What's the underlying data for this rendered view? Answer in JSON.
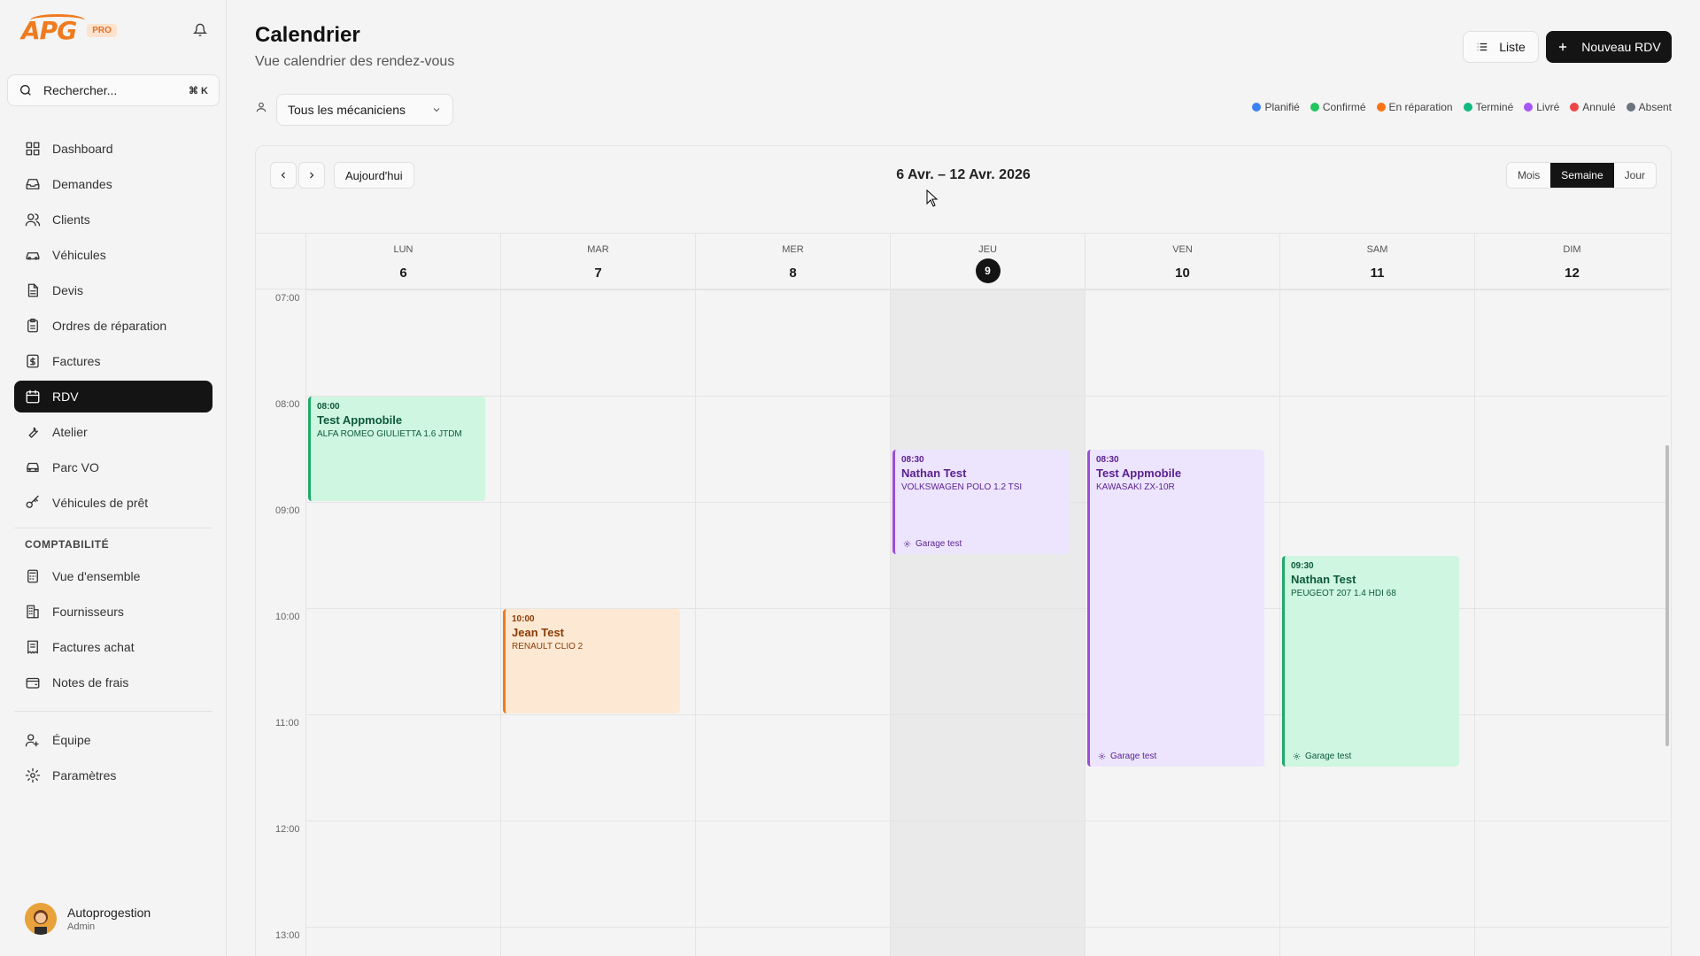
{
  "app": {
    "logo_text": "APG",
    "badge": "PRO"
  },
  "search": {
    "placeholder": "Rechercher...",
    "shortcut": "⌘ K"
  },
  "nav": {
    "items": [
      {
        "label": "Dashboard",
        "icon": "dashboard-icon"
      },
      {
        "label": "Demandes",
        "icon": "inbox-icon"
      },
      {
        "label": "Clients",
        "icon": "users-icon"
      },
      {
        "label": "Véhicules",
        "icon": "car-icon"
      },
      {
        "label": "Devis",
        "icon": "document-icon"
      },
      {
        "label": "Ordres de réparation",
        "icon": "clipboard-icon"
      },
      {
        "label": "Factures",
        "icon": "invoice-icon"
      },
      {
        "label": "RDV",
        "icon": "calendar-icon"
      },
      {
        "label": "Atelier",
        "icon": "wrench-icon"
      },
      {
        "label": "Parc VO",
        "icon": "car-front-icon"
      },
      {
        "label": "Véhicules de prêt",
        "icon": "key-icon"
      }
    ],
    "section_accounting": "COMPTABILITÉ",
    "accounting_items": [
      {
        "label": "Vue d'ensemble",
        "icon": "calculator-icon"
      },
      {
        "label": "Fournisseurs",
        "icon": "building-icon"
      },
      {
        "label": "Factures achat",
        "icon": "receipt-icon"
      },
      {
        "label": "Notes de frais",
        "icon": "wallet-icon"
      }
    ],
    "bottom_items": [
      {
        "label": "Équipe",
        "icon": "team-icon"
      },
      {
        "label": "Paramètres",
        "icon": "settings-icon"
      }
    ]
  },
  "user": {
    "name": "Autoprogestion",
    "role": "Admin"
  },
  "header": {
    "title": "Calendrier",
    "subtitle": "Vue calendrier des rendez-vous",
    "list_button": "Liste",
    "new_button": "Nouveau RDV"
  },
  "filter": {
    "mechanic_select": "Tous les mécaniciens"
  },
  "legend": [
    {
      "label": "Planifié",
      "color": "#3b82f6"
    },
    {
      "label": "Confirmé",
      "color": "#22c55e"
    },
    {
      "label": "En réparation",
      "color": "#f97316"
    },
    {
      "label": "Terminé",
      "color": "#10b981"
    },
    {
      "label": "Livré",
      "color": "#a855f7"
    },
    {
      "label": "Annulé",
      "color": "#ef4444"
    },
    {
      "label": "Absent",
      "color": "#6b7280"
    }
  ],
  "calendar": {
    "today_button": "Aujourd'hui",
    "range": "6 Avr. – 12 Avr. 2026",
    "views": [
      "Mois",
      "Semaine",
      "Jour"
    ],
    "active_view": "Semaine",
    "days": [
      {
        "name": "LUN",
        "num": "6"
      },
      {
        "name": "MAR",
        "num": "7"
      },
      {
        "name": "MER",
        "num": "8"
      },
      {
        "name": "JEU",
        "num": "9",
        "today": true
      },
      {
        "name": "VEN",
        "num": "10"
      },
      {
        "name": "SAM",
        "num": "11"
      },
      {
        "name": "DIM",
        "num": "12"
      }
    ],
    "hours": [
      "07:00",
      "08:00",
      "09:00",
      "10:00",
      "11:00",
      "12:00",
      "13:00"
    ],
    "events": [
      {
        "day": 0,
        "start": 8.0,
        "end": 9.0,
        "time": "08:00",
        "name": "Test Appmobile",
        "vehicle": "ALFA ROMEO GIULIETTA 1.6 JTDM",
        "garage": "",
        "color": "green"
      },
      {
        "day": 1,
        "start": 10.0,
        "end": 11.0,
        "time": "10:00",
        "name": "Jean Test",
        "vehicle": "Renault Clio 2",
        "garage": "",
        "color": "orange"
      },
      {
        "day": 3,
        "start": 8.5,
        "end": 9.5,
        "time": "08:30",
        "name": "Nathan Test",
        "vehicle": "VOLKSWAGEN POLO 1.2 TSI",
        "garage": "Garage test",
        "color": "purple"
      },
      {
        "day": 4,
        "start": 8.5,
        "end": 11.5,
        "time": "08:30",
        "name": "Test Appmobile",
        "vehicle": "Kawasaki ZX-10R",
        "garage": "Garage test",
        "color": "purple"
      },
      {
        "day": 5,
        "start": 9.5,
        "end": 11.5,
        "time": "09:30",
        "name": "Nathan Test",
        "vehicle": "PEUGEOT 207 1.4 HDI 68",
        "garage": "Garage test",
        "color": "green"
      }
    ]
  }
}
